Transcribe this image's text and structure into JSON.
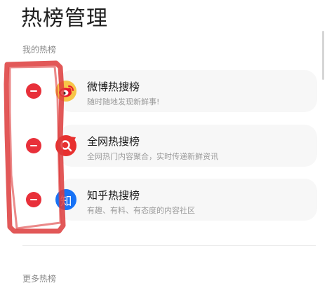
{
  "header": {
    "title": "热榜管理"
  },
  "sections": {
    "mine_label": "我的热榜",
    "more_label": "更多热榜"
  },
  "items": [
    {
      "title": "微博热搜榜",
      "subtitle": "随时随地发现新鲜事!",
      "icon": "weibo-icon",
      "action": "remove-icon"
    },
    {
      "title": "全网热搜榜",
      "subtitle": "全网热门内容聚合，实时传递新鲜资讯",
      "icon": "search-logo-icon",
      "action": "remove-icon"
    },
    {
      "title": "知乎热搜榜",
      "subtitle": "有趣、有料、有态度的内容社区",
      "icon": "zhihu-icon",
      "logo_text": "知",
      "action": "remove-icon"
    }
  ],
  "colors": {
    "remove": "#e8303a",
    "weibo_bg": "#f7c548",
    "weibo_mark": "#e6162d",
    "search_logo": "#e8302f",
    "zhihu_logo": "#1772f6",
    "annotation": "#dd3b3b"
  }
}
